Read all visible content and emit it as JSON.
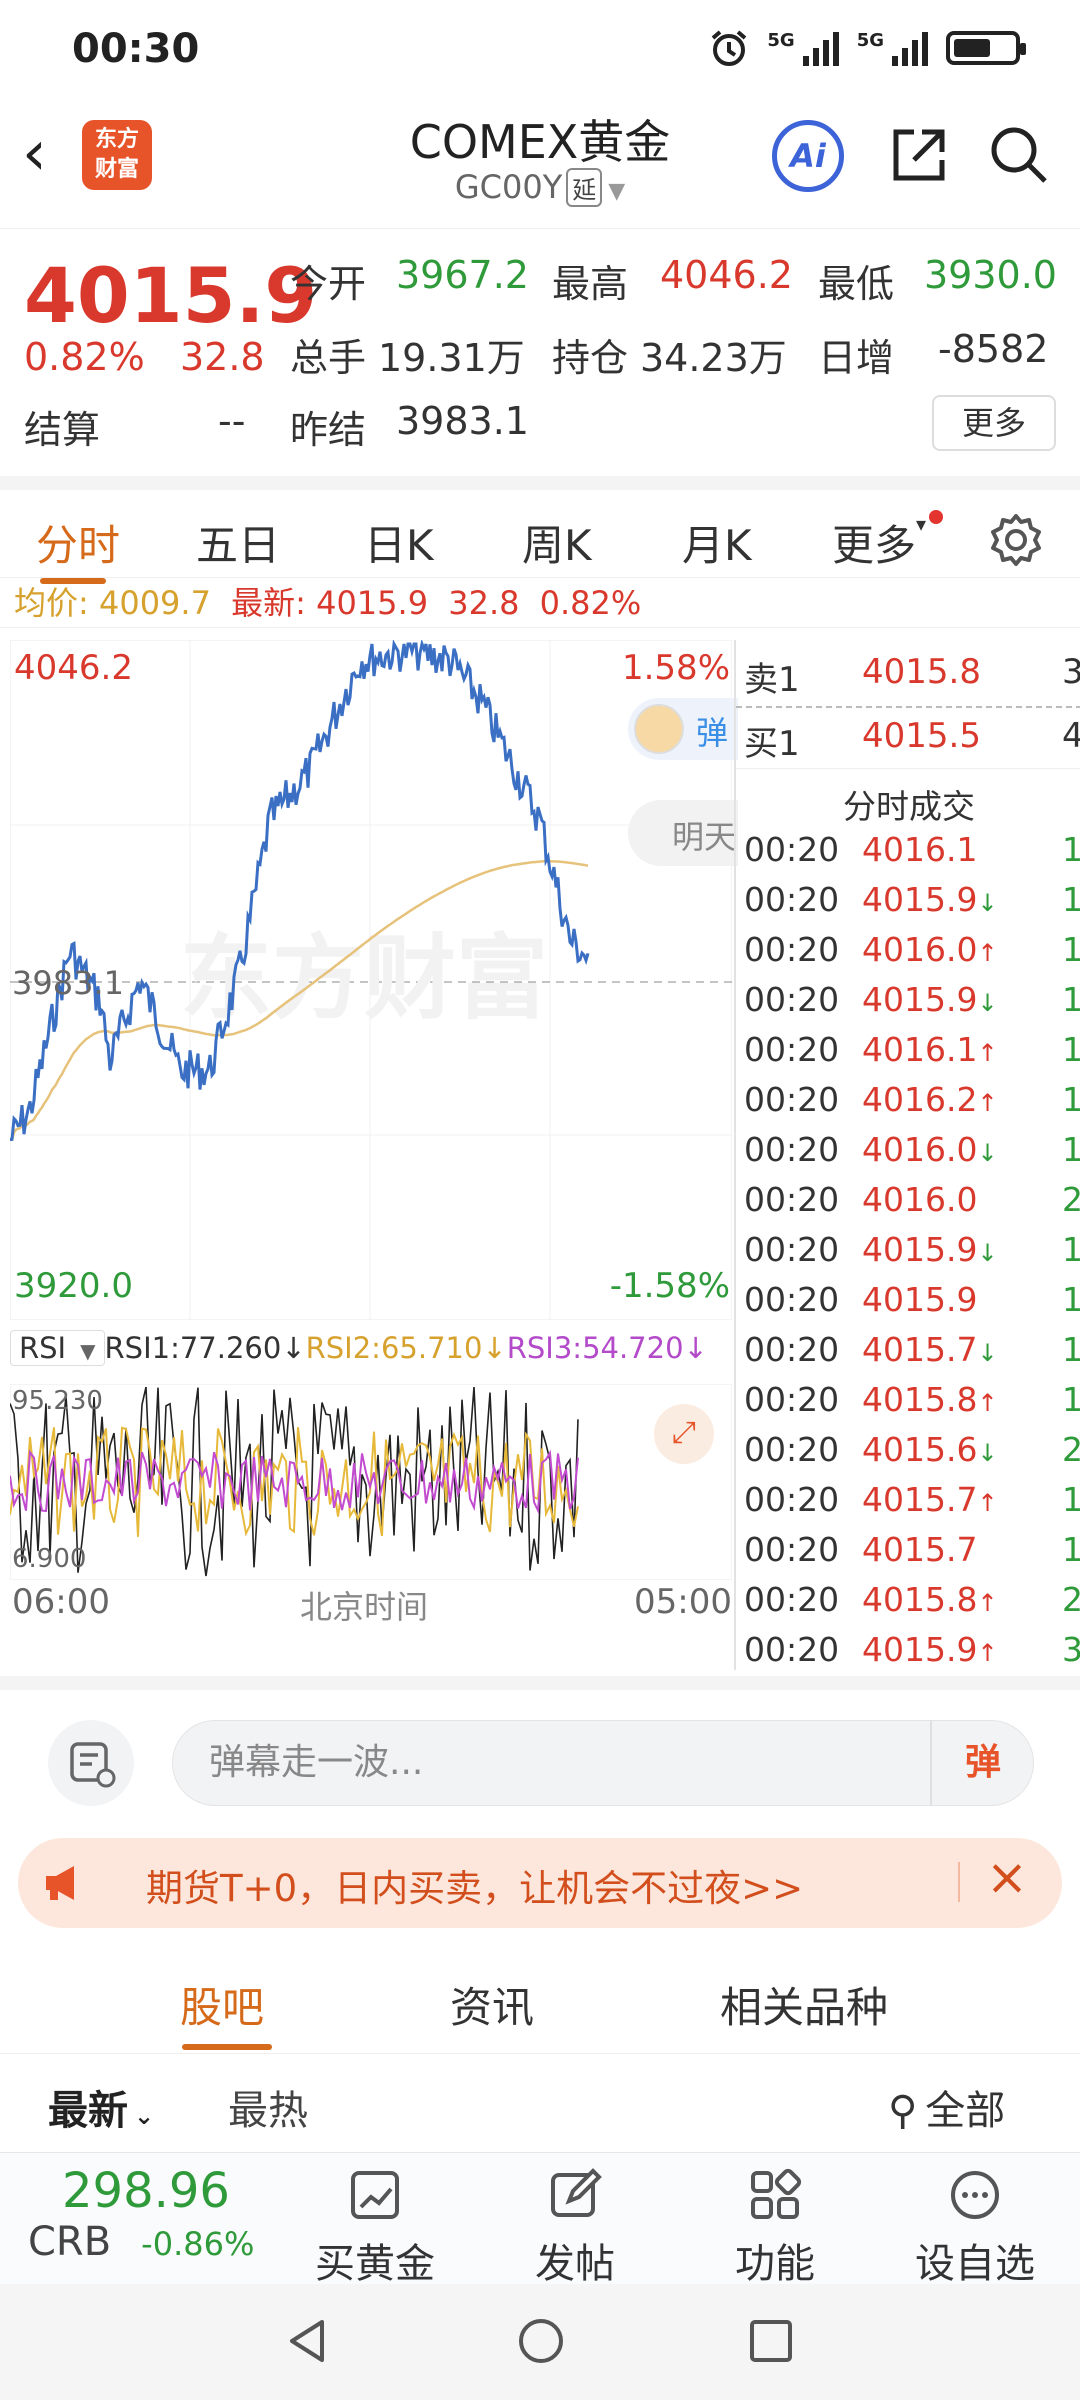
{
  "status": {
    "time": "00:30",
    "net1": "5G",
    "net2": "5G"
  },
  "header": {
    "logo_text_1": "东方",
    "logo_text_2": "财富",
    "title": "COMEX黄金",
    "code": "GC00Y",
    "delay_tag": "延",
    "ai_label": "Ai"
  },
  "quote": {
    "price": "4015.9",
    "pct": "0.82%",
    "change": "32.8",
    "open_label": "今开",
    "open": "3967.2",
    "high_label": "最高",
    "high": "4046.2",
    "low_label": "最低",
    "low": "3930.0",
    "volume_label": "总手",
    "volume": "19.31万",
    "oi_label": "持仓",
    "oi": "34.23万",
    "daily_inc_label": "日增",
    "daily_inc": "-8582",
    "settle_label": "结算",
    "settle": "--",
    "prev_settle_label": "昨结",
    "prev_settle": "3983.1",
    "more_label": "更多"
  },
  "chart_tabs": [
    "分时",
    "五日",
    "日K",
    "周K",
    "月K",
    "更多"
  ],
  "info_line": {
    "avg_label": "均价:",
    "avg": "4009.7",
    "latest_label": "最新:",
    "latest": "4015.9",
    "chg": "32.8",
    "pct": "0.82%"
  },
  "chart_labels": {
    "y_max": "4046.2",
    "y_min": "3920.0",
    "y_ref": "3983.1",
    "pct_max": "1.58%",
    "pct_min": "-1.58%",
    "danmaku_bubble": "弹",
    "tomorrow_bubble": "明天",
    "watermark": "东方财富",
    "rsi_selector": "RSI",
    "rsi1": "RSI1:77.260↓",
    "rsi2": "RSI2:65.710↓",
    "rsi3": "RSI3:54.720↓",
    "rsi_max": "95.230",
    "rsi_min": "6.900",
    "x_start": "06:00",
    "x_mid": "北京时间",
    "x_end": "05:00"
  },
  "orderbook": {
    "sell_label": "卖1",
    "sell_price": "4015.8",
    "sell_vol": "3",
    "buy_label": "买1",
    "buy_price": "4015.5",
    "buy_vol": "4",
    "trades_title": "分时成交"
  },
  "trades": [
    {
      "time": "00:20",
      "price": "4016.1",
      "arrow": "",
      "vol": "1"
    },
    {
      "time": "00:20",
      "price": "4015.9",
      "arrow": "↓",
      "vol": "1"
    },
    {
      "time": "00:20",
      "price": "4016.0",
      "arrow": "↑",
      "vol": "1"
    },
    {
      "time": "00:20",
      "price": "4015.9",
      "arrow": "↓",
      "vol": "1"
    },
    {
      "time": "00:20",
      "price": "4016.1",
      "arrow": "↑",
      "vol": "1"
    },
    {
      "time": "00:20",
      "price": "4016.2",
      "arrow": "↑",
      "vol": "1"
    },
    {
      "time": "00:20",
      "price": "4016.0",
      "arrow": "↓",
      "vol": "1"
    },
    {
      "time": "00:20",
      "price": "4016.0",
      "arrow": "",
      "vol": "2"
    },
    {
      "time": "00:20",
      "price": "4015.9",
      "arrow": "↓",
      "vol": "1"
    },
    {
      "time": "00:20",
      "price": "4015.9",
      "arrow": "",
      "vol": "1"
    },
    {
      "time": "00:20",
      "price": "4015.7",
      "arrow": "↓",
      "vol": "1"
    },
    {
      "time": "00:20",
      "price": "4015.8",
      "arrow": "↑",
      "vol": "1"
    },
    {
      "time": "00:20",
      "price": "4015.6",
      "arrow": "↓",
      "vol": "2"
    },
    {
      "time": "00:20",
      "price": "4015.7",
      "arrow": "↑",
      "vol": "1"
    },
    {
      "time": "00:20",
      "price": "4015.7",
      "arrow": "",
      "vol": "1"
    },
    {
      "time": "00:20",
      "price": "4015.8",
      "arrow": "↑",
      "vol": "2"
    },
    {
      "time": "00:20",
      "price": "4015.9",
      "arrow": "↑",
      "vol": "3"
    }
  ],
  "danmaku": {
    "placeholder": "弹幕走一波...",
    "send_label": "弹"
  },
  "promo": {
    "text": "期货T+0，日内买卖，让机会不过夜>>"
  },
  "community_tabs": [
    "股吧",
    "资讯",
    "相关品种"
  ],
  "filter": {
    "latest": "最新",
    "hot": "最热",
    "all": "全部"
  },
  "bottom_bar": {
    "crb_value": "298.96",
    "crb_label": "CRB",
    "crb_pct": "-0.86%",
    "buy_gold": "买黄金",
    "post": "发帖",
    "functions": "功能",
    "watchlist": "设自选"
  },
  "colors": {
    "up": "#d9382c",
    "down": "#2f9a3a",
    "accent": "#d66a1b",
    "line": "#3a6fc4",
    "avg_line": "#e6c27a"
  }
}
